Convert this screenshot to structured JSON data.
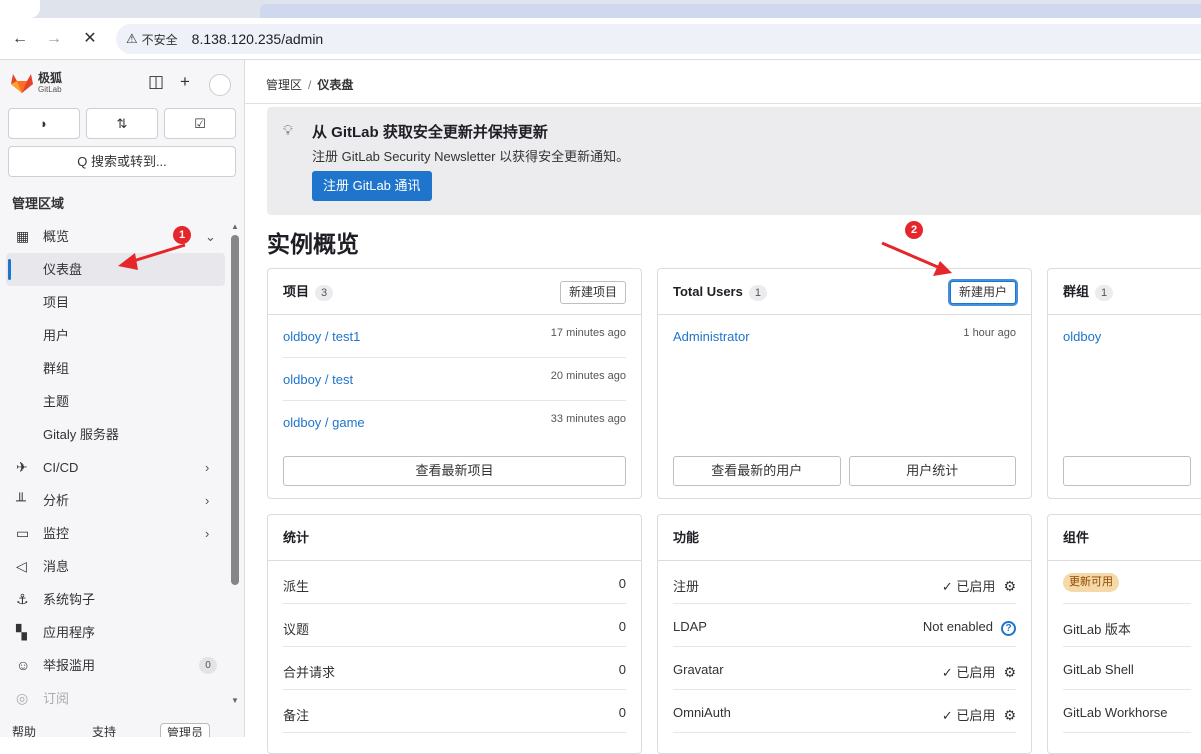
{
  "browser": {
    "security_label": "不安全",
    "url": "8.138.120.235/admin"
  },
  "sidebar": {
    "brand_line1": "极狐",
    "brand_line2": "GitLab",
    "search_label": "Q 搜索或转到...",
    "section_title": "管理区域",
    "items": [
      {
        "label": "概览",
        "icon": "overview-icon",
        "chevron": "⌄"
      },
      {
        "label": "仪表盘",
        "active": true
      },
      {
        "label": "项目"
      },
      {
        "label": "用户"
      },
      {
        "label": "群组"
      },
      {
        "label": "主题"
      },
      {
        "label": "Gitaly 服务器"
      },
      {
        "label": "CI/CD",
        "icon": "rocket-icon",
        "chevron": "›"
      },
      {
        "label": "分析",
        "icon": "chart-icon",
        "chevron": "›"
      },
      {
        "label": "监控",
        "icon": "monitor-icon",
        "chevron": "›"
      },
      {
        "label": "消息",
        "icon": "megaphone-icon"
      },
      {
        "label": "系统钩子",
        "icon": "anchor-icon"
      },
      {
        "label": "应用程序",
        "icon": "apps-icon"
      },
      {
        "label": "举报滥用",
        "icon": "smiley-icon",
        "count": "0"
      },
      {
        "label": "订阅",
        "icon": "subscription-icon"
      }
    ],
    "bottom": {
      "help": "帮助",
      "support": "支持",
      "admin": "管理员"
    }
  },
  "markers": {
    "one": "1",
    "two": "2"
  },
  "breadcrumb": {
    "parent": "管理区",
    "current": "仪表盘"
  },
  "banner": {
    "title": "从 GitLab 获取安全更新并保持更新",
    "desc": "注册 GitLab Security Newsletter 以获得安全更新通知。",
    "button": "注册 GitLab 通讯"
  },
  "page_title": "实例概览",
  "projects_card": {
    "title": "项目",
    "count": "3",
    "new_button": "新建项目",
    "rows": [
      {
        "name": "oldboy / test1",
        "time": "17 minutes ago"
      },
      {
        "name": "oldboy / test",
        "time": "20 minutes ago"
      },
      {
        "name": "oldboy / game",
        "time": "33 minutes ago"
      }
    ],
    "footer_button": "查看最新项目"
  },
  "users_card": {
    "title": "Total Users",
    "count": "1",
    "new_button": "新建用户",
    "rows": [
      {
        "name": "Administrator",
        "time": "1 hour ago"
      }
    ],
    "footer_buttons": [
      "查看最新的用户",
      "用户统计"
    ]
  },
  "groups_card": {
    "title": "群组",
    "count": "1",
    "rows": [
      {
        "name": "oldboy"
      }
    ]
  },
  "stats_card": {
    "title": "统计",
    "rows": [
      {
        "label": "派生",
        "value": "0"
      },
      {
        "label": "议题",
        "value": "0"
      },
      {
        "label": "合并请求",
        "value": "0"
      },
      {
        "label": "备注",
        "value": "0"
      }
    ]
  },
  "features_card": {
    "title": "功能",
    "rows": [
      {
        "label": "注册",
        "value": "✓ 已启用"
      },
      {
        "label": "LDAP",
        "value": "Not enabled"
      },
      {
        "label": "Gravatar",
        "value": "✓ 已启用"
      },
      {
        "label": "OmniAuth",
        "value": "✓ 已启用"
      }
    ]
  },
  "components_card": {
    "title": "组件",
    "badge": "更新可用",
    "rows": [
      {
        "label": "GitLab 版本"
      },
      {
        "label": "GitLab Shell"
      },
      {
        "label": "GitLab Workhorse"
      }
    ]
  }
}
